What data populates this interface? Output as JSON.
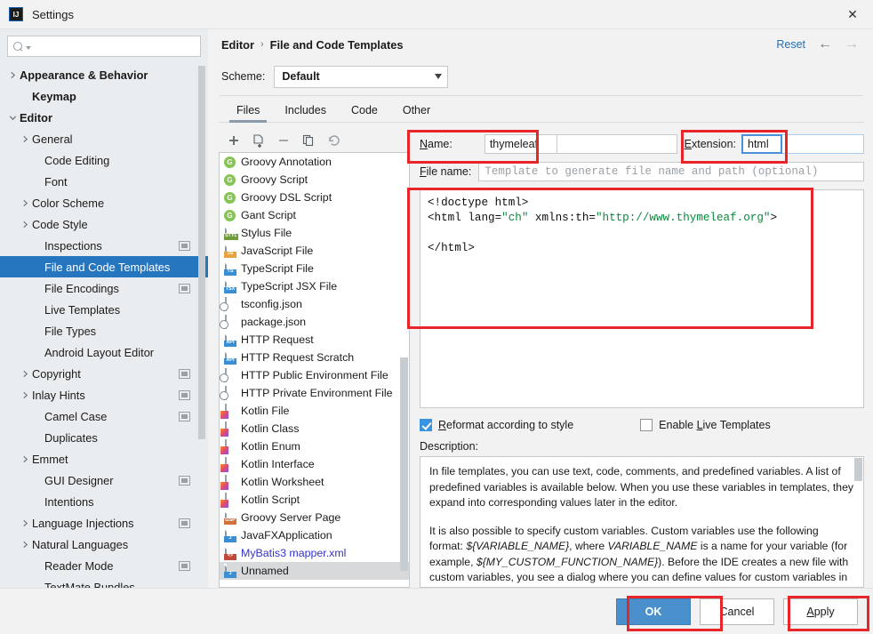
{
  "window": {
    "title": "Settings",
    "logo_text": "IJ",
    "close_icon": "close-icon"
  },
  "sidebar": {
    "search": {
      "value": "",
      "placeholder": ""
    },
    "items": [
      {
        "label": "Appearance & Behavior",
        "indent": 0,
        "twisty": "right",
        "bold": true,
        "badge": false,
        "selected": false
      },
      {
        "label": "Keymap",
        "indent": 1,
        "twisty": "none",
        "bold": true,
        "badge": false,
        "selected": false
      },
      {
        "label": "Editor",
        "indent": 0,
        "twisty": "down",
        "bold": true,
        "badge": false,
        "selected": false
      },
      {
        "label": "General",
        "indent": 1,
        "twisty": "right",
        "bold": false,
        "badge": false,
        "selected": false
      },
      {
        "label": "Code Editing",
        "indent": 2,
        "twisty": "none",
        "bold": false,
        "badge": false,
        "selected": false
      },
      {
        "label": "Font",
        "indent": 2,
        "twisty": "none",
        "bold": false,
        "badge": false,
        "selected": false
      },
      {
        "label": "Color Scheme",
        "indent": 1,
        "twisty": "right",
        "bold": false,
        "badge": false,
        "selected": false
      },
      {
        "label": "Code Style",
        "indent": 1,
        "twisty": "right",
        "bold": false,
        "badge": false,
        "selected": false
      },
      {
        "label": "Inspections",
        "indent": 2,
        "twisty": "none",
        "bold": false,
        "badge": true,
        "selected": false
      },
      {
        "label": "File and Code Templates",
        "indent": 2,
        "twisty": "none",
        "bold": false,
        "badge": false,
        "selected": true
      },
      {
        "label": "File Encodings",
        "indent": 2,
        "twisty": "none",
        "bold": false,
        "badge": true,
        "selected": false
      },
      {
        "label": "Live Templates",
        "indent": 2,
        "twisty": "none",
        "bold": false,
        "badge": false,
        "selected": false
      },
      {
        "label": "File Types",
        "indent": 2,
        "twisty": "none",
        "bold": false,
        "badge": false,
        "selected": false
      },
      {
        "label": "Android Layout Editor",
        "indent": 2,
        "twisty": "none",
        "bold": false,
        "badge": false,
        "selected": false
      },
      {
        "label": "Copyright",
        "indent": 1,
        "twisty": "right",
        "bold": false,
        "badge": true,
        "selected": false
      },
      {
        "label": "Inlay Hints",
        "indent": 1,
        "twisty": "right",
        "bold": false,
        "badge": true,
        "selected": false
      },
      {
        "label": "Camel Case",
        "indent": 2,
        "twisty": "none",
        "bold": false,
        "badge": true,
        "selected": false
      },
      {
        "label": "Duplicates",
        "indent": 2,
        "twisty": "none",
        "bold": false,
        "badge": false,
        "selected": false
      },
      {
        "label": "Emmet",
        "indent": 1,
        "twisty": "right",
        "bold": false,
        "badge": false,
        "selected": false
      },
      {
        "label": "GUI Designer",
        "indent": 2,
        "twisty": "none",
        "bold": false,
        "badge": true,
        "selected": false
      },
      {
        "label": "Intentions",
        "indent": 2,
        "twisty": "none",
        "bold": false,
        "badge": false,
        "selected": false
      },
      {
        "label": "Language Injections",
        "indent": 1,
        "twisty": "right",
        "bold": false,
        "badge": true,
        "selected": false
      },
      {
        "label": "Natural Languages",
        "indent": 1,
        "twisty": "right",
        "bold": false,
        "badge": false,
        "selected": false
      },
      {
        "label": "Reader Mode",
        "indent": 2,
        "twisty": "none",
        "bold": false,
        "badge": true,
        "selected": false
      },
      {
        "label": "TextMate Bundles",
        "indent": 2,
        "twisty": "none",
        "bold": false,
        "badge": false,
        "selected": false
      }
    ],
    "help_label": "?"
  },
  "header": {
    "breadcrumb": [
      "Editor",
      "File and Code Templates"
    ],
    "breadcrumb_separator": "›",
    "reset_label": "Reset",
    "back_icon": "arrow-left-icon",
    "forward_icon": "arrow-right-icon"
  },
  "scheme": {
    "label": "Scheme:",
    "value": "Default"
  },
  "tabs": [
    {
      "label": "Files",
      "active": true
    },
    {
      "label": "Includes",
      "active": false
    },
    {
      "label": "Code",
      "active": false
    },
    {
      "label": "Other",
      "active": false
    }
  ],
  "toolbar": {
    "add_icon": "plus-icon",
    "create_from_file_icon": "create-template-icon",
    "remove_icon": "minus-icon",
    "copy_icon": "copy-icon",
    "reset_icon": "undo-icon"
  },
  "file_list": [
    {
      "label": "Groovy Annotation",
      "icon": "groovy",
      "badge": "G",
      "selected": false,
      "link": false
    },
    {
      "label": "Groovy Script",
      "icon": "groovy",
      "badge": "G",
      "selected": false,
      "link": false
    },
    {
      "label": "Groovy DSL Script",
      "icon": "groovy",
      "badge": "G",
      "selected": false,
      "link": false
    },
    {
      "label": "Gant Script",
      "icon": "groovy",
      "badge": "G",
      "selected": false,
      "link": false
    },
    {
      "label": "Stylus File",
      "icon": "doc",
      "badge": "STYL",
      "badge_color": "#6f9b3e",
      "selected": false,
      "link": false
    },
    {
      "label": "JavaScript File",
      "icon": "doc",
      "badge": "JS",
      "badge_color": "#e8a33d",
      "selected": false,
      "link": false
    },
    {
      "label": "TypeScript File",
      "icon": "doc",
      "badge": "TS",
      "badge_color": "#3a8fd4",
      "selected": false,
      "link": false
    },
    {
      "label": "TypeScript JSX File",
      "icon": "doc",
      "badge": "TSX",
      "badge_color": "#3a8fd4",
      "selected": false,
      "link": false
    },
    {
      "label": "tsconfig.json",
      "icon": "json",
      "badge": "",
      "selected": false,
      "link": false
    },
    {
      "label": "package.json",
      "icon": "json",
      "badge": "",
      "selected": false,
      "link": false
    },
    {
      "label": "HTTP Request",
      "icon": "doc",
      "badge": "API",
      "badge_color": "#3a8fd4",
      "selected": false,
      "link": false
    },
    {
      "label": "HTTP Request Scratch",
      "icon": "doc",
      "badge": "API",
      "badge_color": "#3a8fd4",
      "selected": false,
      "link": false
    },
    {
      "label": "HTTP Public Environment File",
      "icon": "json",
      "badge": "",
      "selected": false,
      "link": false
    },
    {
      "label": "HTTP Private Environment File",
      "icon": "json",
      "badge": "",
      "selected": false,
      "link": false
    },
    {
      "label": "Kotlin File",
      "icon": "kotlin",
      "badge": "",
      "selected": false,
      "link": false
    },
    {
      "label": "Kotlin Class",
      "icon": "kotlin",
      "badge": "",
      "selected": false,
      "link": false
    },
    {
      "label": "Kotlin Enum",
      "icon": "kotlin",
      "badge": "",
      "selected": false,
      "link": false
    },
    {
      "label": "Kotlin Interface",
      "icon": "kotlin",
      "badge": "",
      "selected": false,
      "link": false
    },
    {
      "label": "Kotlin Worksheet",
      "icon": "kotlin",
      "badge": "",
      "selected": false,
      "link": false
    },
    {
      "label": "Kotlin Script",
      "icon": "kotlin",
      "badge": "",
      "selected": false,
      "link": false
    },
    {
      "label": "Groovy Server Page",
      "icon": "doc",
      "badge": "GSP",
      "badge_color": "#d4703a",
      "selected": false,
      "link": false
    },
    {
      "label": "JavaFXApplication",
      "icon": "doc",
      "badge": "J",
      "badge_color": "#3a8fd4",
      "selected": false,
      "link": false
    },
    {
      "label": "MyBatis3 mapper.xml",
      "icon": "doc",
      "badge": "<>",
      "badge_color": "#c4483a",
      "selected": false,
      "link": true
    },
    {
      "label": "Unnamed",
      "icon": "doc",
      "badge": "J",
      "badge_color": "#3a8fd4",
      "selected": true,
      "link": false
    }
  ],
  "detail": {
    "name_label": "Name:",
    "name_label_mnemonic": "N",
    "name_value": "thymeleaf",
    "extension_label": "Extension:",
    "extension_label_mnemonic": "E",
    "extension_value": "html",
    "filename_label": "File name:",
    "filename_label_mnemonic": "F",
    "filename_value": "",
    "filename_placeholder": "Template to generate file name and path (optional)",
    "editor_lines": [
      {
        "segments": [
          {
            "text": "<!doctype html>",
            "color": "plain"
          }
        ]
      },
      {
        "segments": [
          {
            "text": "<html lang=",
            "color": "plain"
          },
          {
            "text": "\"ch\"",
            "color": "green"
          },
          {
            "text": " xmlns:th=",
            "color": "plain"
          },
          {
            "text": "\"http://www.thymeleaf.org\"",
            "color": "green"
          },
          {
            "text": ">",
            "color": "plain"
          }
        ]
      },
      {
        "segments": [
          {
            "text": "",
            "color": "plain"
          }
        ]
      },
      {
        "segments": [
          {
            "text": "</html>",
            "color": "plain"
          }
        ]
      }
    ],
    "reformat_label": "Reformat according to style",
    "reformat_mnemonic": "R",
    "reformat_checked": true,
    "live_templates_label": "Enable Live Templates",
    "live_templates_mnemonic": "L",
    "live_templates_checked": false,
    "description_label": "Description:",
    "description_paragraphs": [
      "In file templates, you can use text, code, comments, and predefined variables. A list of predefined variables is available below. When you use these variables in templates, they expand into corresponding values later in the editor.",
      "It is also possible to specify custom variables. Custom variables use the following format: ${VARIABLE_NAME}, where VARIABLE_NAME is a name for your variable (for example, ${MY_CUSTOM_FUNCTION_NAME}). Before the IDE creates a new file with custom variables, you see a dialog where you can define values for custom variables in the template."
    ]
  },
  "footer": {
    "ok_label": "OK",
    "cancel_label": "Cancel",
    "apply_label": "Apply",
    "apply_mnemonic": "A"
  },
  "colors": {
    "selection_blue": "#2675bf",
    "primary_button": "#4a90cc",
    "link_blue": "#2470b3",
    "annotation_red": "#e8262a",
    "string_green": "#088a3c"
  }
}
